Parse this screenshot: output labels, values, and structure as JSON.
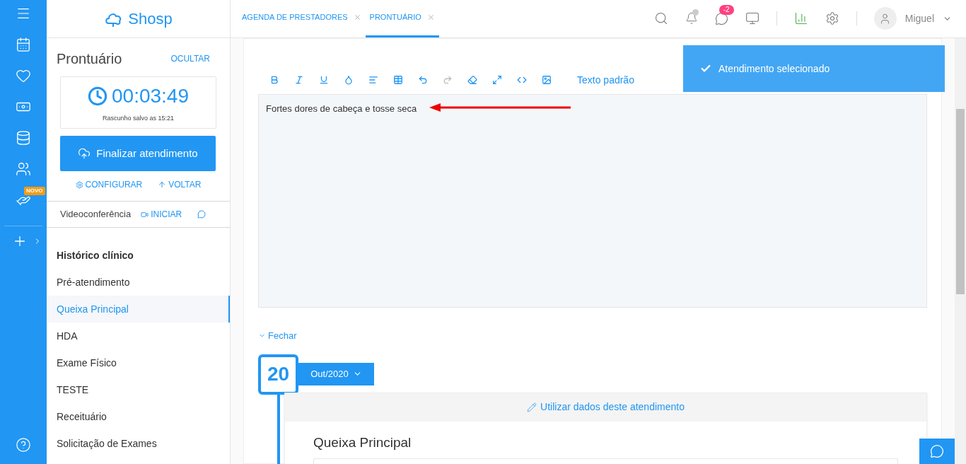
{
  "rail": {
    "badge": "NOVO"
  },
  "brand": {
    "name": "Shosp"
  },
  "panel": {
    "title": "Prontuário",
    "hide": "OCULTAR",
    "timer": "00:03:49",
    "saved": "Rascunho salvo as 15:21",
    "finish": "Finalizar atendimento",
    "configure": "CONFIGURAR",
    "back": "VOLTAR"
  },
  "video": {
    "label": "Videoconferência",
    "start": "INICIAR"
  },
  "menu": [
    {
      "label": "Histórico clínico",
      "kind": "heading",
      "selected": false
    },
    {
      "label": "Pré-atendimento",
      "kind": "item",
      "selected": false
    },
    {
      "label": "Queixa Principal",
      "kind": "item",
      "selected": true
    },
    {
      "label": "HDA",
      "kind": "item",
      "selected": false
    },
    {
      "label": "Exame Físico",
      "kind": "item",
      "selected": false
    },
    {
      "label": "TESTE",
      "kind": "item",
      "selected": false
    },
    {
      "label": "Receituário",
      "kind": "item",
      "selected": false
    },
    {
      "label": "Solicitação de Exames",
      "kind": "item",
      "selected": false
    }
  ],
  "tabs": [
    {
      "label": "AGENDA DE PRESTADORES",
      "selected": false
    },
    {
      "label": "PRONTUÁRIO",
      "selected": true
    }
  ],
  "header": {
    "chat_badge": "-2",
    "user": "Miguel"
  },
  "editor": {
    "links": [
      "Texto padrão"
    ],
    "text": "Fortes dores de cabeça e tosse seca"
  },
  "toast": {
    "message": "Atendimento selecionado"
  },
  "history": {
    "close": "Fechar",
    "day": "20",
    "month": "Out/2020",
    "use_data": "Utilizar dados deste atendimento",
    "section": "Queixa Principal"
  }
}
